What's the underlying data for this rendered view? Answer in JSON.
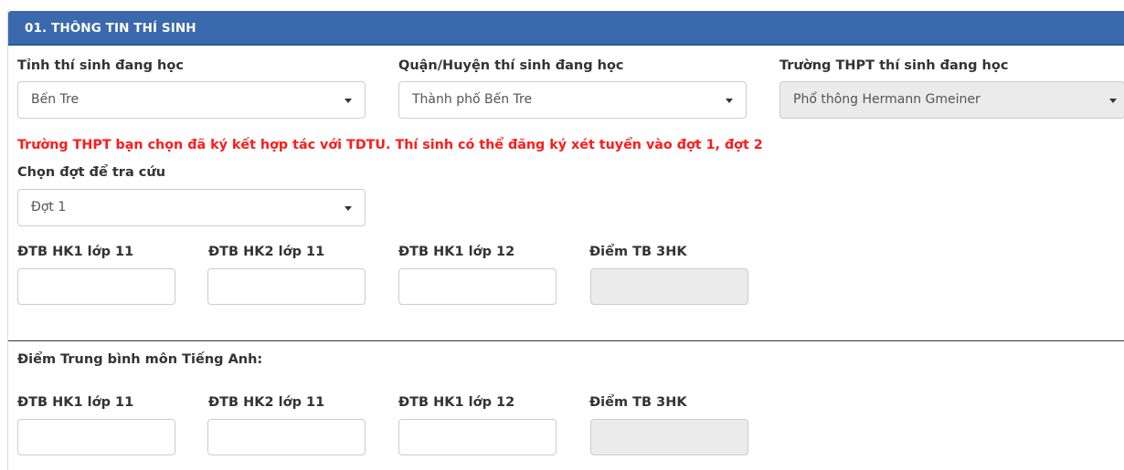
{
  "section": {
    "title": "01. THÔNG TIN THÍ SINH"
  },
  "province": {
    "label": "Tỉnh thí sinh đang học",
    "value": "Bến Tre"
  },
  "district": {
    "label": "Quận/Huyện thí sinh đang học",
    "value": "Thành phố Bến Tre"
  },
  "school": {
    "label": "Trường THPT thí sinh đang học",
    "value": "Phổ thông Hermann Gmeiner"
  },
  "notice": "Trường THPT bạn chọn đã ký kết hợp tác với TDTU. Thí sinh có thể đăng ký xét tuyển vào đợt 1, đợt 2",
  "round": {
    "label": "Chọn đợt để tra cứu",
    "value": "Đợt 1"
  },
  "gpa": {
    "hk1_11": "ĐTB HK1 lớp 11",
    "hk2_11": "ĐTB HK2 lớp 11",
    "hk1_12": "ĐTB HK1 lớp 12",
    "avg": "Điểm TB 3HK"
  },
  "english": {
    "title": "Điểm Trung bình môn Tiếng Anh:",
    "hk1_11": "ĐTB HK1 lớp 11",
    "hk2_11": "ĐTB HK2 lớp 11",
    "hk1_12": "ĐTB HK1 lớp 12",
    "avg": "Điểm TB 3HK"
  },
  "colors": {
    "header_bg": "#3a6aad",
    "notice": "#ff1a1a",
    "disabled_bg": "#ebebeb"
  }
}
